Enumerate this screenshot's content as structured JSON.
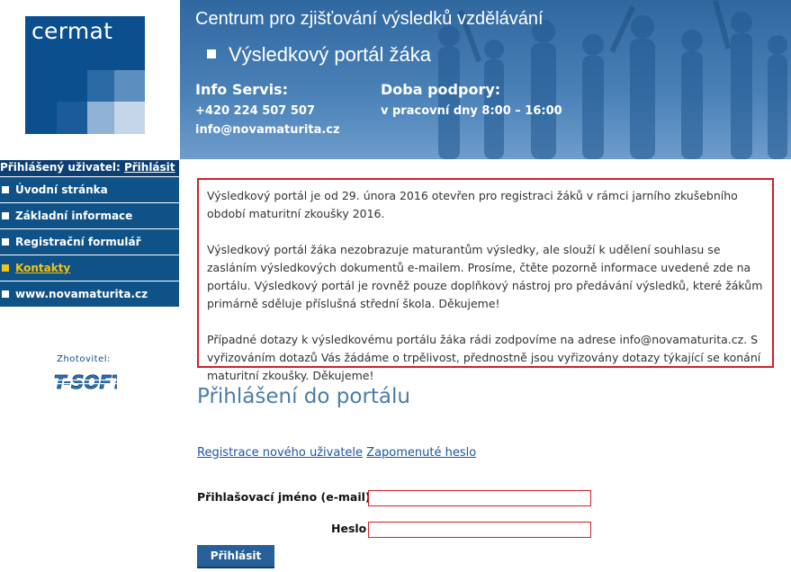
{
  "header": {
    "logo_text": "cermat",
    "title": "Centrum pro zjišťování výsledků vzdělávání",
    "subtitle": "Výsledkový portál žáka",
    "info_servis": {
      "heading": "Info Servis:",
      "phone": "+420 224 507 507",
      "email": "info@novamaturita.cz"
    },
    "support": {
      "heading": "Doba podpory:",
      "hours": "v pracovní dny 8:00 – 16:00"
    }
  },
  "user": {
    "label": "Přihlášený uživatel:",
    "login_link": "Přihlásit"
  },
  "nav": {
    "items": [
      {
        "label": "Úvodní stránka"
      },
      {
        "label": "Základní informace"
      },
      {
        "label": "Registrační formulář"
      },
      {
        "label": "Kontakty"
      },
      {
        "label": "www.novamaturita.cz"
      }
    ]
  },
  "maker": {
    "label": "Zhotovitel:",
    "logo_text": "T-SOFT"
  },
  "notice": {
    "p1": "Výsledkový portál je od 29. února 2016 otevřen pro registraci žáků v rámci jarního zkušebního období maturitní zkoušky 2016.",
    "p2": "Výsledkový portál žáka nezobrazuje maturantům výsledky, ale slouží k udělení souhlasu se zasláním výsledkových dokumentů e-mailem. Prosíme, čtěte pozorně informace uvedené zde na portálu. Výsledkový portál je rovněž pouze doplňkový nástroj pro předávání výsledků, které žákům primárně sděluje příslušná střední škola. Děkujeme!",
    "p3": "Případné dotazy k výsledkovému portálu žáka rádi zodpovíme na adrese info@novamaturita.cz. S vyřizováním dotazů Vás žádáme o trpělivost, přednostně jsou vyřizovány dotazy týkající se konání maturitní zkoušky. Děkujeme!"
  },
  "login": {
    "title": "Přihlášení do portálu",
    "register_link": "Registrace nového uživatele",
    "forgot_link": "Zapomenuté heslo",
    "username_label": "Přihlašovací jméno (e-mail)",
    "username_value": "",
    "password_label": "Heslo",
    "password_value": "",
    "submit_label": "Přihlásit"
  },
  "colors": {
    "brand_blue": "#0f5287",
    "dark_blue": "#0c3f73",
    "accent_yellow": "#f2c318",
    "error_red": "#d2202c",
    "link_blue": "#1e56a0"
  }
}
